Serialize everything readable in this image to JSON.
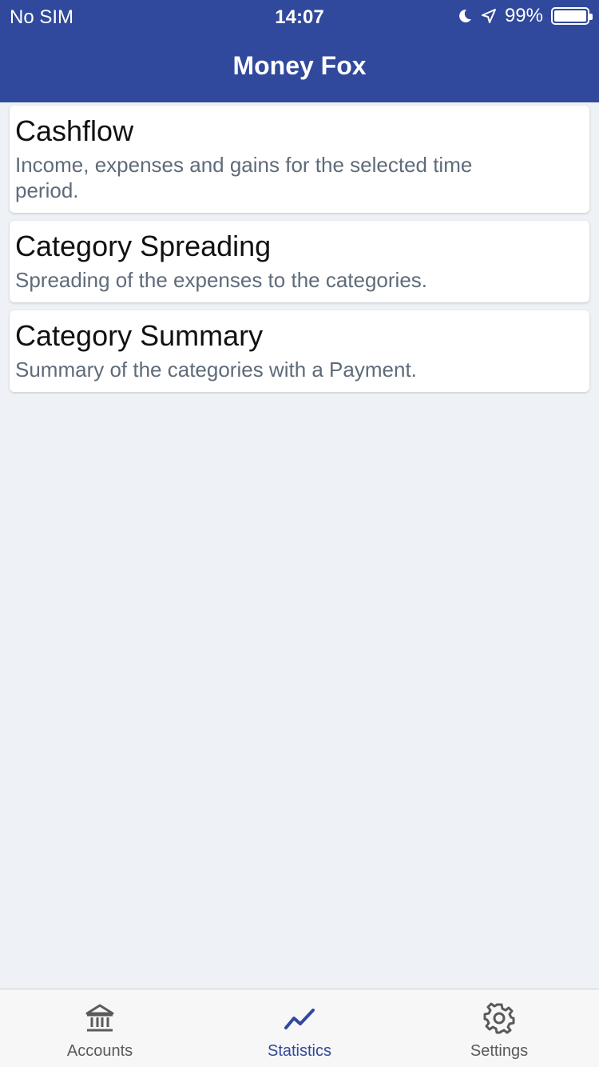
{
  "status_bar": {
    "carrier": "No SIM",
    "time": "14:07",
    "battery": "99%",
    "battery_level": 0.99,
    "icons": [
      "moon-icon",
      "location-arrow-icon",
      "battery-icon"
    ]
  },
  "header": {
    "title": "Money Fox"
  },
  "statistics": [
    {
      "title": "Cashflow",
      "description": "Income, expenses and gains for the selected time period."
    },
    {
      "title": "Category Spreading",
      "description": "Spreading of the expenses to the categories."
    },
    {
      "title": "Category Summary",
      "description": "Summary of the categories with a Payment."
    }
  ],
  "tabbar": {
    "active": "Statistics",
    "tabs": [
      {
        "label": "Accounts",
        "icon": "bank-icon"
      },
      {
        "label": "Statistics",
        "icon": "line-chart-icon"
      },
      {
        "label": "Settings",
        "icon": "gear-icon"
      }
    ]
  },
  "colors": {
    "primary": "#30499c",
    "background": "#eef1f5",
    "card": "#ffffff",
    "description_text": "#5f6b7a"
  }
}
